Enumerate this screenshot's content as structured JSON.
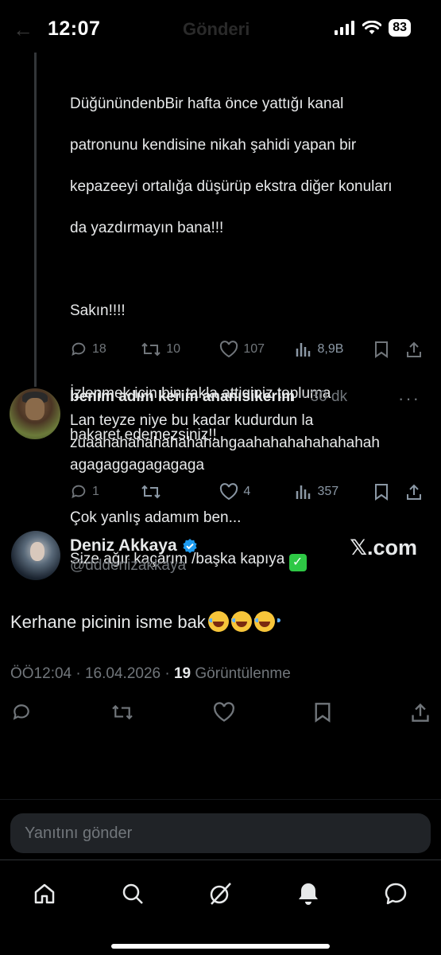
{
  "status_bar": {
    "time": "12:07",
    "battery": "83",
    "ghost_back": "←",
    "ghost_title": "Gönderi"
  },
  "thread_tweet": {
    "text_lines": [
      "DüğünündenbBir hafta önce yattığı kanal",
      "patronunu kendisine nikah şahidi yapan bir",
      "kepazeeyi ortalığa düşürüp ekstra diğer konuları",
      "da yazdırmayın bana!!!",
      "",
      "Sakın!!!!",
      "",
      "İzlenmek için bin takla  attiginiz topluma",
      "hakaret edemezsiniz!!",
      "",
      "Çok yanlış adamım ben...",
      "Size ağır kaçarım /başka kapıya"
    ],
    "check_emoji": "✓",
    "replies": "18",
    "reposts": "10",
    "likes": "107",
    "views": "8,9B"
  },
  "reply_tweet": {
    "name": "benim adım kerim ananısikerim",
    "time": "· 30 dk",
    "more": "···",
    "text": "Lan teyze niye bu kadar kudurdun la\nzuaahahahahahahahahgaahahahahahahahah\nagagaggagagagaga",
    "replies": "1",
    "reposts": "",
    "likes": "4",
    "views": "357"
  },
  "main_tweet": {
    "name": "Deniz Akkaya",
    "handle": "@dddenizakkaya",
    "watermark": "𝕏.com",
    "text": "Kerhane picinin isme bak",
    "time": "ÖÖ12:04 · 16.04.2026 ·",
    "views_count": "19",
    "views_label": "Görüntülenme"
  },
  "reply_input": {
    "placeholder": "Yanıtını gönder"
  },
  "nav": {
    "items": [
      "home-icon",
      "search-icon",
      "grok-icon",
      "notifications-icon",
      "messages-icon"
    ]
  },
  "colors": {
    "background": "#000000",
    "text": "#e7e9ea",
    "muted": "#71767b",
    "verified": "#1d9bf0",
    "input_bg": "#202327"
  }
}
